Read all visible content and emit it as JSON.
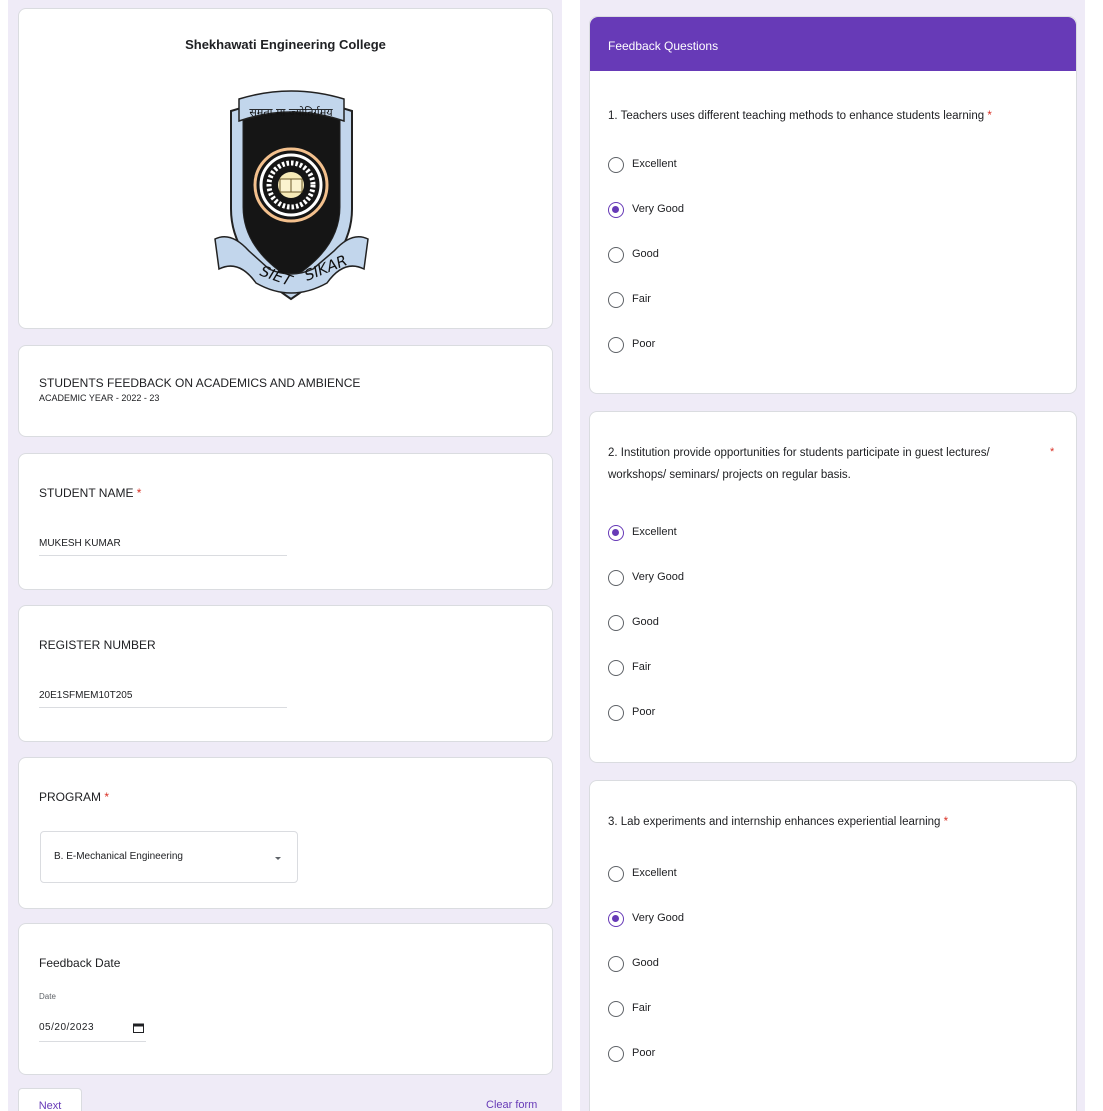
{
  "left": {
    "college_name": "Shekhawati Engineering College",
    "logo": {
      "motto": "समता मा ज्योतिर्गमय",
      "text_left": "SIET",
      "text_right": "SIKAR"
    },
    "form_title": "STUDENTS FEEDBACK ON ACADEMICS AND AMBIENCE",
    "form_subtitle": "ACADEMIC YEAR - 2022 - 23",
    "student_name": {
      "label": "STUDENT NAME",
      "required": "*",
      "value": "MUKESH KUMAR"
    },
    "register_number": {
      "label": "REGISTER NUMBER",
      "value": "20E1SFMEM10T205"
    },
    "program": {
      "label": "PROGRAM",
      "required": "*",
      "value": "B. E-Mechanical Engineering",
      "icon": "chevron-down-icon"
    },
    "feedback_date": {
      "label": "Feedback Date",
      "sublabel": "Date",
      "value": "05/20/2023",
      "icon": "calendar-icon"
    },
    "next_label": "Next",
    "clear_label": "Clear form"
  },
  "right": {
    "section_title": "Feedback Questions",
    "q1": {
      "text": "1.  Teachers uses different teaching methods to enhance students learning",
      "required": "*",
      "options": [
        "Excellent",
        "Very Good",
        "Good",
        "Fair",
        "Poor"
      ],
      "selected": "Very Good"
    },
    "q2": {
      "line1": "2.  Institution provide opportunities for students participate in guest lectures/",
      "line2": "workshops/ seminars/ projects on regular basis.",
      "required": "*",
      "options": [
        "Excellent",
        "Very Good",
        "Good",
        "Fair",
        "Poor"
      ],
      "selected": "Excellent"
    },
    "q3": {
      "text": "3.  Lab experiments and internship enhances experiential learning",
      "required": "*",
      "options": [
        "Excellent",
        "Very Good",
        "Good",
        "Fair",
        "Poor"
      ],
      "selected": "Very Good"
    }
  },
  "colors": {
    "accent": "#673ab7",
    "page_bg": "#efebf7",
    "required": "#d93025"
  }
}
